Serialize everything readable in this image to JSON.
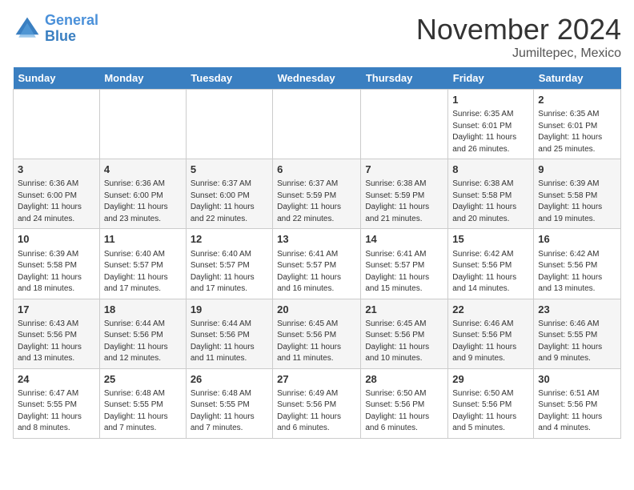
{
  "header": {
    "logo_line1": "General",
    "logo_line2": "Blue",
    "month": "November 2024",
    "location": "Jumiltepec, Mexico"
  },
  "days_of_week": [
    "Sunday",
    "Monday",
    "Tuesday",
    "Wednesday",
    "Thursday",
    "Friday",
    "Saturday"
  ],
  "weeks": [
    [
      {
        "day": "",
        "info": ""
      },
      {
        "day": "",
        "info": ""
      },
      {
        "day": "",
        "info": ""
      },
      {
        "day": "",
        "info": ""
      },
      {
        "day": "",
        "info": ""
      },
      {
        "day": "1",
        "info": "Sunrise: 6:35 AM\nSunset: 6:01 PM\nDaylight: 11 hours and 26 minutes."
      },
      {
        "day": "2",
        "info": "Sunrise: 6:35 AM\nSunset: 6:01 PM\nDaylight: 11 hours and 25 minutes."
      }
    ],
    [
      {
        "day": "3",
        "info": "Sunrise: 6:36 AM\nSunset: 6:00 PM\nDaylight: 11 hours and 24 minutes."
      },
      {
        "day": "4",
        "info": "Sunrise: 6:36 AM\nSunset: 6:00 PM\nDaylight: 11 hours and 23 minutes."
      },
      {
        "day": "5",
        "info": "Sunrise: 6:37 AM\nSunset: 6:00 PM\nDaylight: 11 hours and 22 minutes."
      },
      {
        "day": "6",
        "info": "Sunrise: 6:37 AM\nSunset: 5:59 PM\nDaylight: 11 hours and 22 minutes."
      },
      {
        "day": "7",
        "info": "Sunrise: 6:38 AM\nSunset: 5:59 PM\nDaylight: 11 hours and 21 minutes."
      },
      {
        "day": "8",
        "info": "Sunrise: 6:38 AM\nSunset: 5:58 PM\nDaylight: 11 hours and 20 minutes."
      },
      {
        "day": "9",
        "info": "Sunrise: 6:39 AM\nSunset: 5:58 PM\nDaylight: 11 hours and 19 minutes."
      }
    ],
    [
      {
        "day": "10",
        "info": "Sunrise: 6:39 AM\nSunset: 5:58 PM\nDaylight: 11 hours and 18 minutes."
      },
      {
        "day": "11",
        "info": "Sunrise: 6:40 AM\nSunset: 5:57 PM\nDaylight: 11 hours and 17 minutes."
      },
      {
        "day": "12",
        "info": "Sunrise: 6:40 AM\nSunset: 5:57 PM\nDaylight: 11 hours and 17 minutes."
      },
      {
        "day": "13",
        "info": "Sunrise: 6:41 AM\nSunset: 5:57 PM\nDaylight: 11 hours and 16 minutes."
      },
      {
        "day": "14",
        "info": "Sunrise: 6:41 AM\nSunset: 5:57 PM\nDaylight: 11 hours and 15 minutes."
      },
      {
        "day": "15",
        "info": "Sunrise: 6:42 AM\nSunset: 5:56 PM\nDaylight: 11 hours and 14 minutes."
      },
      {
        "day": "16",
        "info": "Sunrise: 6:42 AM\nSunset: 5:56 PM\nDaylight: 11 hours and 13 minutes."
      }
    ],
    [
      {
        "day": "17",
        "info": "Sunrise: 6:43 AM\nSunset: 5:56 PM\nDaylight: 11 hours and 13 minutes."
      },
      {
        "day": "18",
        "info": "Sunrise: 6:44 AM\nSunset: 5:56 PM\nDaylight: 11 hours and 12 minutes."
      },
      {
        "day": "19",
        "info": "Sunrise: 6:44 AM\nSunset: 5:56 PM\nDaylight: 11 hours and 11 minutes."
      },
      {
        "day": "20",
        "info": "Sunrise: 6:45 AM\nSunset: 5:56 PM\nDaylight: 11 hours and 11 minutes."
      },
      {
        "day": "21",
        "info": "Sunrise: 6:45 AM\nSunset: 5:56 PM\nDaylight: 11 hours and 10 minutes."
      },
      {
        "day": "22",
        "info": "Sunrise: 6:46 AM\nSunset: 5:56 PM\nDaylight: 11 hours and 9 minutes."
      },
      {
        "day": "23",
        "info": "Sunrise: 6:46 AM\nSunset: 5:55 PM\nDaylight: 11 hours and 9 minutes."
      }
    ],
    [
      {
        "day": "24",
        "info": "Sunrise: 6:47 AM\nSunset: 5:55 PM\nDaylight: 11 hours and 8 minutes."
      },
      {
        "day": "25",
        "info": "Sunrise: 6:48 AM\nSunset: 5:55 PM\nDaylight: 11 hours and 7 minutes."
      },
      {
        "day": "26",
        "info": "Sunrise: 6:48 AM\nSunset: 5:55 PM\nDaylight: 11 hours and 7 minutes."
      },
      {
        "day": "27",
        "info": "Sunrise: 6:49 AM\nSunset: 5:56 PM\nDaylight: 11 hours and 6 minutes."
      },
      {
        "day": "28",
        "info": "Sunrise: 6:50 AM\nSunset: 5:56 PM\nDaylight: 11 hours and 6 minutes."
      },
      {
        "day": "29",
        "info": "Sunrise: 6:50 AM\nSunset: 5:56 PM\nDaylight: 11 hours and 5 minutes."
      },
      {
        "day": "30",
        "info": "Sunrise: 6:51 AM\nSunset: 5:56 PM\nDaylight: 11 hours and 4 minutes."
      }
    ]
  ]
}
